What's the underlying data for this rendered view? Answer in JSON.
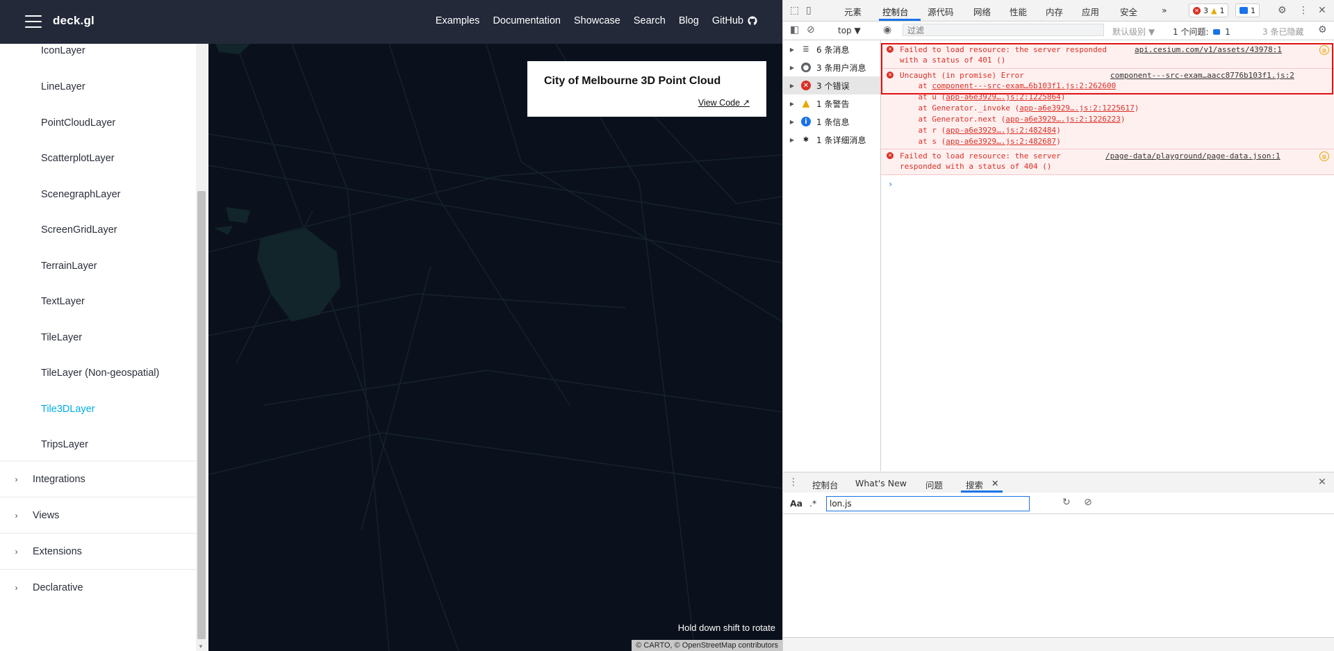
{
  "site": {
    "brand": "deck.gl",
    "nav": [
      "Examples",
      "Documentation",
      "Showcase",
      "Search",
      "Blog",
      "GitHub"
    ],
    "sidebar_items": [
      "IconLayer",
      "LineLayer",
      "PointCloudLayer",
      "ScatterplotLayer",
      "ScenegraphLayer",
      "ScreenGridLayer",
      "TerrainLayer",
      "TextLayer",
      "TileLayer",
      "TileLayer (Non-geospatial)",
      "Tile3DLayer",
      "TripsLayer"
    ],
    "active_item": "Tile3DLayer",
    "sidebar_sections": [
      "Integrations",
      "Views",
      "Extensions",
      "Declarative"
    ],
    "info_card": {
      "title": "City of Melbourne 3D Point Cloud",
      "link": "View Code ↗"
    },
    "rotate_hint": "Hold down shift to rotate",
    "attribution": "© CARTO, © OpenStreetMap contributors"
  },
  "devtools": {
    "tabs": [
      "元素",
      "控制台",
      "源代码",
      "网络",
      "性能",
      "内存",
      "应用",
      "安全",
      "»"
    ],
    "active_tab": "控制台",
    "badges": {
      "errors": "3",
      "warnings": "1",
      "messages": "1"
    },
    "toolbar": {
      "context": "top ▼",
      "filter_placeholder": "过滤",
      "level": "默认级别 ▼",
      "issues_label": "1 个问题:",
      "issues_count": "1",
      "hidden": "3 条已隐藏"
    },
    "sidebar": [
      {
        "label": "6 条消息",
        "icon": "list"
      },
      {
        "label": "3 条用户消息",
        "icon": "user"
      },
      {
        "label": "3 个错误",
        "icon": "error"
      },
      {
        "label": "1 条警告",
        "icon": "warning"
      },
      {
        "label": "1 条信息",
        "icon": "info"
      },
      {
        "label": "1 条详细消息",
        "icon": "verbose"
      }
    ],
    "messages": [
      {
        "lines": [
          "Failed to load resource: the server responded",
          "with a status of 401 ()"
        ],
        "source": "api.cesium.com/v1/assets/43978:1"
      },
      {
        "lines": [
          "Uncaught (in promise) Error"
        ],
        "source": "component---src-exam…aacc8776b103f1.js:2",
        "trace": [
          {
            "fn": "    at ",
            "link": "component---src-exam…6b103f1.js:2:262600",
            "end": ""
          },
          {
            "fn": "    at u (",
            "link": "app-a6e3929….js:2:1225864",
            "end": ")"
          },
          {
            "fn": "    at Generator._invoke (",
            "link": "app-a6e3929….js:2:1225617",
            "end": ")"
          },
          {
            "fn": "    at Generator.next (",
            "link": "app-a6e3929….js:2:1226223",
            "end": ")"
          },
          {
            "fn": "    at r (",
            "link": "app-a6e3929….js:2:482484",
            "end": ")"
          },
          {
            "fn": "    at s (",
            "link": "app-a6e3929….js:2:482687",
            "end": ")"
          }
        ]
      },
      {
        "lines": [
          "Failed to load resource: the server",
          "responded with a status of 404 ()"
        ],
        "source": "/page-data/playground/page-data.json:1"
      }
    ],
    "drawer_tabs": [
      "控制台",
      "What's New",
      "问题",
      "搜索"
    ],
    "active_drawer": "搜索",
    "search": {
      "case_toggle": "Aa",
      "regex_toggle": ".*",
      "query": "lon.js"
    }
  }
}
